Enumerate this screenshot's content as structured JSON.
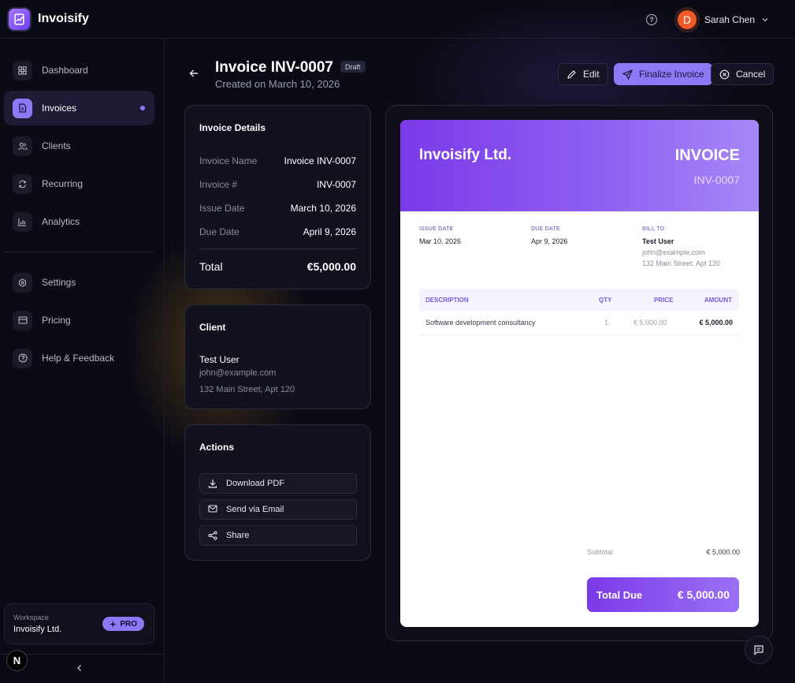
{
  "app": {
    "name": "Invoisify"
  },
  "topbar": {
    "user_initial": "D",
    "user_name": "Sarah Chen"
  },
  "sidebar": {
    "items": [
      {
        "label": "Dashboard",
        "icon": "grid-icon"
      },
      {
        "label": "Invoices",
        "icon": "document-icon",
        "active": true
      },
      {
        "label": "Clients",
        "icon": "users-icon"
      },
      {
        "label": "Recurring",
        "icon": "refresh-icon"
      },
      {
        "label": "Analytics",
        "icon": "bar-chart-icon"
      },
      {
        "label": "Settings",
        "icon": "gear-icon"
      },
      {
        "label": "Pricing",
        "icon": "credit-card-icon"
      },
      {
        "label": "Help & Feedback",
        "icon": "help-icon"
      }
    ],
    "workspace_label": "Workspace",
    "workspace_name": "Invoisify Ltd.",
    "plan_badge": "PRO",
    "n_badge": "N"
  },
  "header": {
    "title": "Invoice INV-0007",
    "status_badge": "Draft",
    "subtitle": "Created on March 10, 2026",
    "edit_label": "Edit",
    "finalize_label": "Finalize Invoice",
    "cancel_label": "Cancel"
  },
  "details": {
    "title": "Invoice Details",
    "rows": [
      {
        "label": "Invoice Name",
        "value": "Invoice INV-0007"
      },
      {
        "label": "Invoice #",
        "value": "INV-0007"
      },
      {
        "label": "Issue Date",
        "value": "March 10, 2026"
      },
      {
        "label": "Due Date",
        "value": "April 9, 2026"
      }
    ],
    "total_label": "Total",
    "total_value": "€5,000.00"
  },
  "client": {
    "title": "Client",
    "name": "Test User",
    "email": "john@example.com",
    "address": "132 Main Street, Apt 120"
  },
  "actions": {
    "title": "Actions",
    "download": "Download PDF",
    "email": "Send via Email",
    "share": "Share"
  },
  "preview": {
    "company": "Invoisify Ltd.",
    "doc_word": "INVOICE",
    "doc_number": "INV-0007",
    "issue_label": "ISSUE DATE",
    "issue_value": "Mar 10, 2026",
    "due_label": "DUE DATE",
    "due_value": "Apr 9, 2026",
    "bill_label": "BILL TO",
    "bill_name": "Test User",
    "bill_email": "john@example.com",
    "bill_address": "132 Main Street, Apt 120",
    "columns": {
      "description": "DESCRIPTION",
      "qty": "QTY",
      "price": "PRICE",
      "amount": "AMOUNT"
    },
    "line_items": [
      {
        "description": "Software development consultancy",
        "qty": "1",
        "price": "€ 5,000.00",
        "amount": "€ 5,000.00"
      }
    ],
    "subtotal_label": "Subtotal",
    "subtotal_value": "€ 5,000.00",
    "total_due_label": "Total Due",
    "total_due_value": "€ 5,000.00"
  },
  "colors": {
    "accent": "#8d78f5",
    "brand_gradient_start": "#7b3ae8",
    "brand_gradient_end": "#a687f7",
    "avatar": "#ef5a28"
  }
}
